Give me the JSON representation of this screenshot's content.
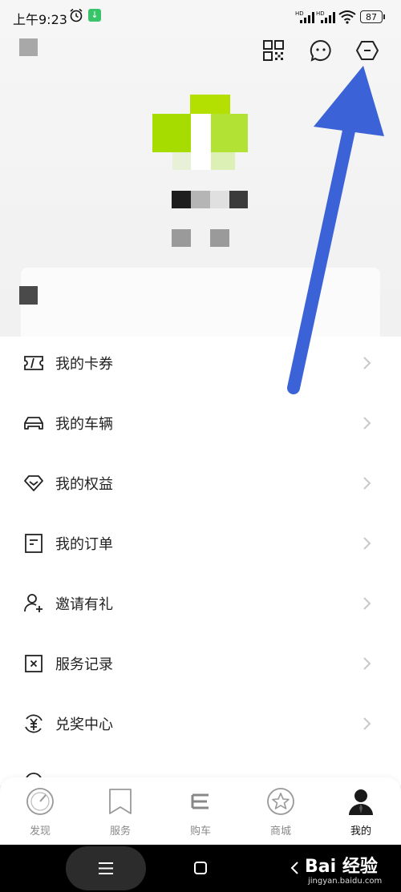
{
  "status_bar": {
    "time": "上午9:23",
    "signal_label": "HD",
    "battery": "87"
  },
  "menu": [
    {
      "label": "我的卡券",
      "icon": "ticket-icon"
    },
    {
      "label": "我的车辆",
      "icon": "car-icon"
    },
    {
      "label": "我的权益",
      "icon": "diamond-icon"
    },
    {
      "label": "我的订单",
      "icon": "order-icon"
    },
    {
      "label": "邀请有礼",
      "icon": "invite-user-icon"
    },
    {
      "label": "服务记录",
      "icon": "service-record-icon"
    },
    {
      "label": "兑奖中心",
      "icon": "yuan-exchange-icon"
    }
  ],
  "tabs": [
    {
      "label": "发现",
      "icon": "speedometer-icon"
    },
    {
      "label": "服务",
      "icon": "bookmark-icon"
    },
    {
      "label": "购车",
      "icon": "e-logo-icon"
    },
    {
      "label": "商城",
      "icon": "star-icon"
    },
    {
      "label": "我的",
      "icon": "person-icon",
      "active": true
    }
  ],
  "watermark": {
    "brand": "Bai 经验",
    "url": "jingyan.baidu.com"
  },
  "colors": {
    "arrow": "#3b62d6",
    "accent_green": "#a6df00"
  }
}
